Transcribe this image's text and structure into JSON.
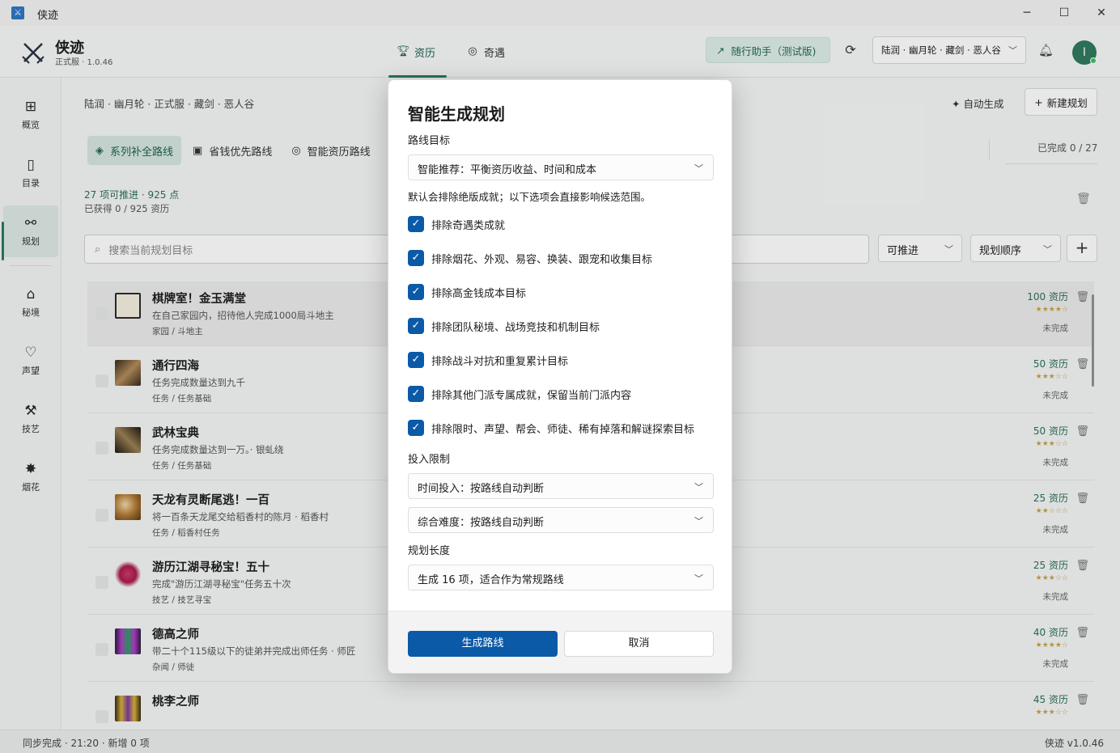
{
  "window": {
    "title": "侠迹",
    "minimize": "─",
    "maximize": "☐",
    "close": "✕"
  },
  "header": {
    "app_name": "侠迹",
    "version": "正式服 · 1.0.46",
    "nav": [
      {
        "label": "资历",
        "icon": "trophy-icon"
      },
      {
        "label": "奇遇",
        "icon": "compass-icon"
      }
    ],
    "assistant_label": "随行助手（测试版)",
    "character": "陆润 · 幽月轮 · 藏剑 · 恶人谷",
    "avatar_letter": "I"
  },
  "sidebar": {
    "items": [
      {
        "label": "概览",
        "icon": "⊞"
      },
      {
        "label": "目录",
        "icon": "▯"
      },
      {
        "label": "规划",
        "icon": "⚯"
      },
      {
        "label": "秘境",
        "icon": "⌂"
      },
      {
        "label": "声望",
        "icon": "♡"
      },
      {
        "label": "技艺",
        "icon": "⚒"
      },
      {
        "label": "烟花",
        "icon": "✸"
      }
    ]
  },
  "main": {
    "breadcrumb": "陆润 · 幽月轮 · 正式服 · 藏剑 · 恶人谷",
    "auto_generate": "自动生成",
    "new_plan": "新建规划",
    "tabs": [
      "系列补全路线",
      "省钱优先路线",
      "智能资历路线"
    ],
    "completed": "已完成 0 / 27",
    "summary1": "27 项可推进 · 925 点",
    "summary2": "已获得 0 / 925 资历",
    "search_placeholder": "搜索当前规划目标",
    "filter1": "可推进",
    "filter2": "规划顺序"
  },
  "rows": [
    {
      "title": "棋牌室！金玉满堂",
      "desc": "在自己家园内，招待他人完成1000局斗地主",
      "cat": "家园 / 斗地主",
      "pts": "100 资历",
      "status": "未完成"
    },
    {
      "title": "通行四海",
      "desc": "任务完成数量达到九千",
      "cat": "任务 / 任务基础",
      "pts": "50 资历",
      "status": "未完成"
    },
    {
      "title": "武林宝典",
      "desc": "任务完成数量达到一万。· 银虬绕",
      "cat": "任务 / 任务基础",
      "pts": "50 资历",
      "status": "未完成"
    },
    {
      "title": "天龙有灵断尾逃！一百",
      "desc": "将一百条天龙尾交给稻香村的陈月 · 稻香村",
      "cat": "任务 / 稻香村任务",
      "pts": "25 资历",
      "status": "未完成"
    },
    {
      "title": "游历江湖寻秘宝！五十",
      "desc": "完成\"游历江湖寻秘宝\"任务五十次",
      "cat": "技艺 / 技艺寻宝",
      "pts": "25 资历",
      "status": "未完成"
    },
    {
      "title": "德高之师",
      "desc": "带二十个115级以下的徒弟并完成出师任务 · 师匠",
      "cat": "杂闻 / 师徒",
      "pts": "40 资历",
      "status": "未完成"
    },
    {
      "title": "桃李之师",
      "desc": "",
      "cat": "",
      "pts": "45 资历",
      "status": ""
    }
  ],
  "statusbar": {
    "left": "同步完成 · 21:20 · 新增 0 项",
    "right": "侠迹 v1.0.46"
  },
  "dialog": {
    "title": "智能生成规划",
    "route_goal_label": "路线目标",
    "route_goal_value": "智能推荐：平衡资历收益、时间和成本",
    "hint": "默认会排除绝版成就；以下选项会直接影响候选范围。",
    "options": [
      "排除奇遇类成就",
      "排除烟花、外观、易容、换装、跟宠和收集目标",
      "排除高金钱成本目标",
      "排除团队秘境、战场竞技和机制目标",
      "排除战斗对抗和重复累计目标",
      "排除其他门派专属成就，保留当前门派内容",
      "排除限时、声望、帮会、师徒、稀有掉落和解谜探索目标"
    ],
    "limit_label": "投入限制",
    "time_value": "时间投入：按路线自动判断",
    "difficulty_value": "综合难度：按路线自动判断",
    "length_label": "规划长度",
    "length_value": "生成 16 项，适合作为常规路线",
    "generate": "生成路线",
    "cancel": "取消"
  }
}
